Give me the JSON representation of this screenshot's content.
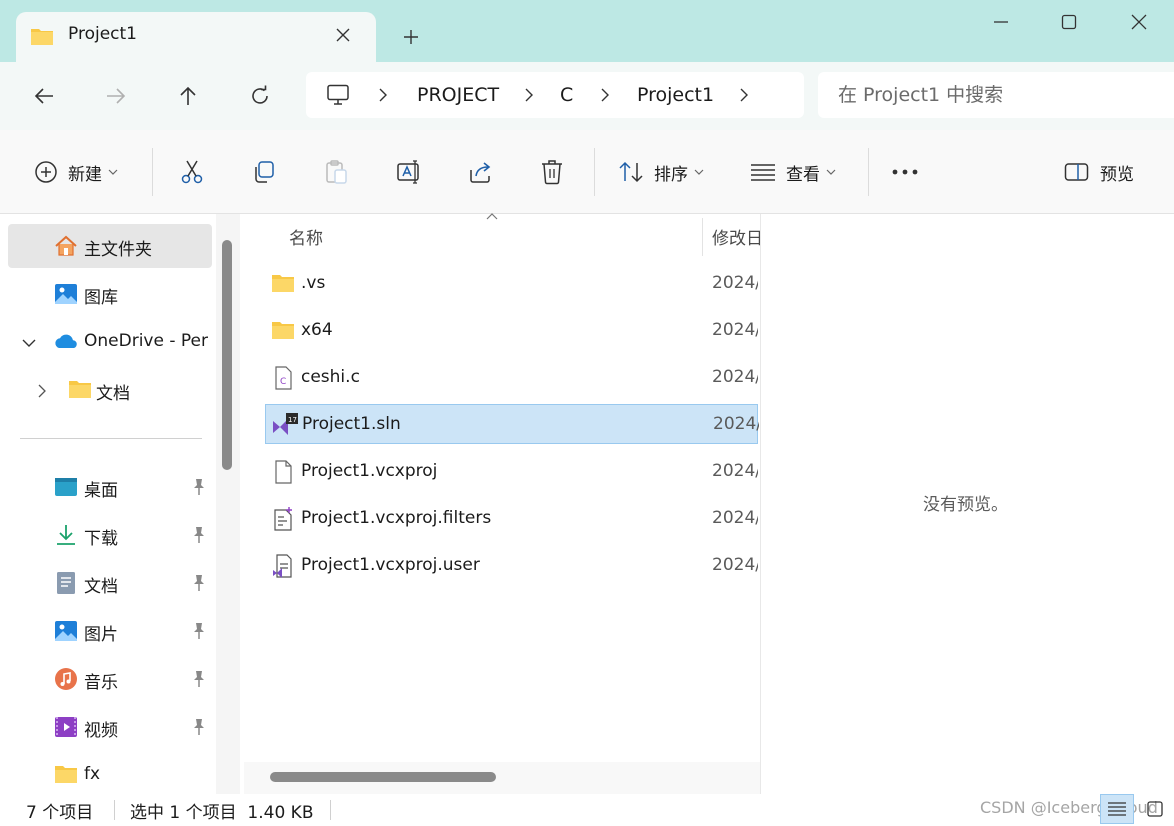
{
  "window": {
    "tab_title": "Project1",
    "tab_icon": "folder-icon",
    "controls": [
      "minimize-icon",
      "maximize-icon",
      "close-icon"
    ]
  },
  "nav": {
    "breadcrumb": [
      "PROJECT",
      "C",
      "Project1"
    ],
    "search_placeholder": "在 Project1 中搜索"
  },
  "toolbar": {
    "new_label": "新建",
    "sort_label": "排序",
    "view_label": "查看",
    "preview_label": "预览",
    "buttons": [
      "cut-icon",
      "copy-icon",
      "paste-icon",
      "rename-icon",
      "share-icon",
      "delete-icon"
    ]
  },
  "sidebar": {
    "items": [
      {
        "label": "主文件夹",
        "icon": "home-icon"
      },
      {
        "label": "图库",
        "icon": "gallery-icon"
      },
      {
        "label": "OneDrive - Per",
        "icon": "onedrive-icon"
      },
      {
        "label": "文档",
        "icon": "folder-icon"
      }
    ],
    "quick_access": [
      {
        "label": "桌面",
        "icon": "desktop-icon",
        "pinned": true
      },
      {
        "label": "下载",
        "icon": "download-icon",
        "pinned": true
      },
      {
        "label": "文档",
        "icon": "documents-icon",
        "pinned": true
      },
      {
        "label": "图片",
        "icon": "pictures-icon",
        "pinned": true
      },
      {
        "label": "音乐",
        "icon": "music-icon",
        "pinned": true
      },
      {
        "label": "视频",
        "icon": "video-icon",
        "pinned": true
      },
      {
        "label": "fx",
        "icon": "folder-icon",
        "pinned": false
      }
    ]
  },
  "filelist": {
    "columns": {
      "name": "名称",
      "modified": "修改日"
    },
    "rows": [
      {
        "name": ".vs",
        "date": "2024/",
        "icon": "folder-icon",
        "selected": false
      },
      {
        "name": "x64",
        "date": "2024/",
        "icon": "folder-icon",
        "selected": false
      },
      {
        "name": "ceshi.c",
        "date": "2024/",
        "icon": "c-file-icon",
        "selected": false
      },
      {
        "name": "Project1.sln",
        "date": "2024/",
        "icon": "visual-studio-solution-icon",
        "selected": true
      },
      {
        "name": "Project1.vcxproj",
        "date": "2024/",
        "icon": "file-icon",
        "selected": false
      },
      {
        "name": "Project1.vcxproj.filters",
        "date": "2024/",
        "icon": "filters-file-icon",
        "selected": false
      },
      {
        "name": "Project1.vcxproj.user",
        "date": "2024/",
        "icon": "vs-user-file-icon",
        "selected": false
      }
    ]
  },
  "preview": {
    "empty_text": "没有预览。"
  },
  "status": {
    "count": "7 个项目",
    "selection": "选中 1 个项目  1.40 KB",
    "watermark": "CSDN @Iceberg_cloud"
  },
  "colors": {
    "titlebar": "#bde8e4",
    "selection": "#cce4f7",
    "folder": "#f8c846"
  }
}
